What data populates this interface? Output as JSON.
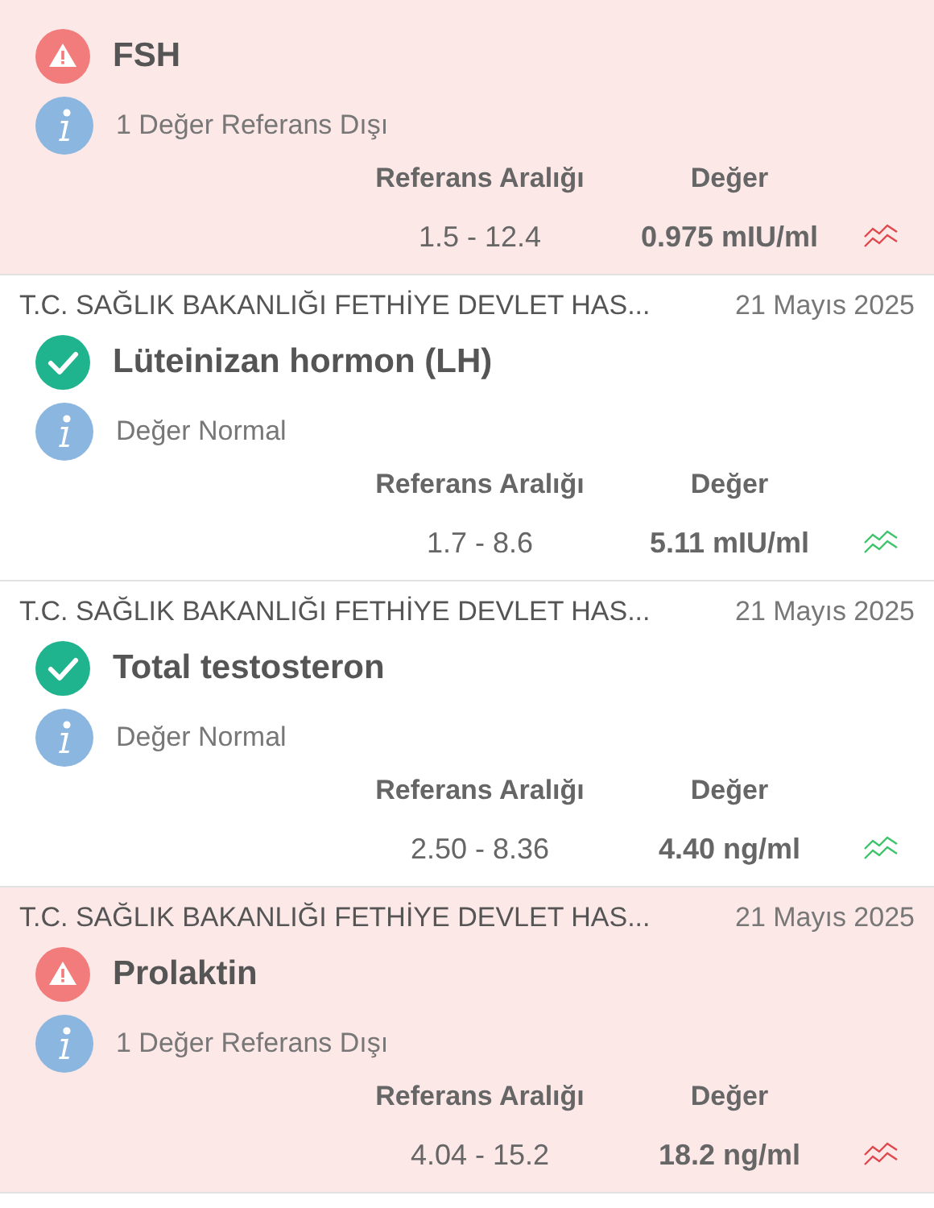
{
  "results": [
    {
      "out_of_range": true,
      "name": "FSH",
      "note": "1 Değer Referans Dışı",
      "range_label": "Referans Aralığı",
      "value_label": "Değer",
      "range": "1.5 - 12.4",
      "value": "0.975 mIU/ml"
    },
    {
      "out_of_range": false,
      "source": "T.C. SAĞLIK BAKANLIĞI FETHİYE DEVLET HAS...",
      "date": "21 Mayıs 2025",
      "name": "Lüteinizan hormon (LH)",
      "note": "Değer Normal",
      "range_label": "Referans Aralığı",
      "value_label": "Değer",
      "range": "1.7 - 8.6",
      "value": "5.11 mIU/ml"
    },
    {
      "out_of_range": false,
      "source": "T.C. SAĞLIK BAKANLIĞI FETHİYE DEVLET HAS...",
      "date": "21 Mayıs 2025",
      "name": "Total testosteron",
      "note": "Değer Normal",
      "range_label": "Referans Aralığı",
      "value_label": "Değer",
      "range": "2.50 - 8.36",
      "value": "4.40 ng/ml"
    },
    {
      "out_of_range": true,
      "source": "T.C. SAĞLIK BAKANLIĞI FETHİYE DEVLET HAS...",
      "date": "21 Mayıs 2025",
      "name": "Prolaktin",
      "note": "1 Değer Referans Dışı",
      "range_label": "Referans Aralığı",
      "value_label": "Değer",
      "range": "4.04 - 15.2",
      "value": "18.2 ng/ml"
    }
  ]
}
